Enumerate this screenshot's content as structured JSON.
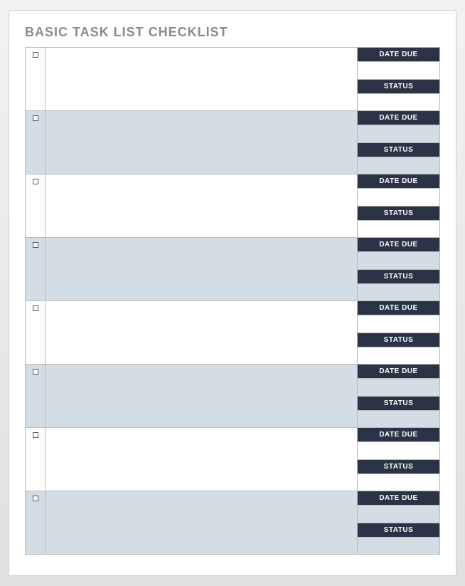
{
  "title": "BASIC TASK LIST CHECKLIST",
  "labels": {
    "date_due": "DATE DUE",
    "status": "STATUS"
  },
  "rows": [
    {
      "checked": false,
      "task": "",
      "date_due": "",
      "status": ""
    },
    {
      "checked": false,
      "task": "",
      "date_due": "",
      "status": ""
    },
    {
      "checked": false,
      "task": "",
      "date_due": "",
      "status": ""
    },
    {
      "checked": false,
      "task": "",
      "date_due": "",
      "status": ""
    },
    {
      "checked": false,
      "task": "",
      "date_due": "",
      "status": ""
    },
    {
      "checked": false,
      "task": "",
      "date_due": "",
      "status": ""
    },
    {
      "checked": false,
      "task": "",
      "date_due": "",
      "status": ""
    },
    {
      "checked": false,
      "task": "",
      "date_due": "",
      "status": ""
    }
  ]
}
